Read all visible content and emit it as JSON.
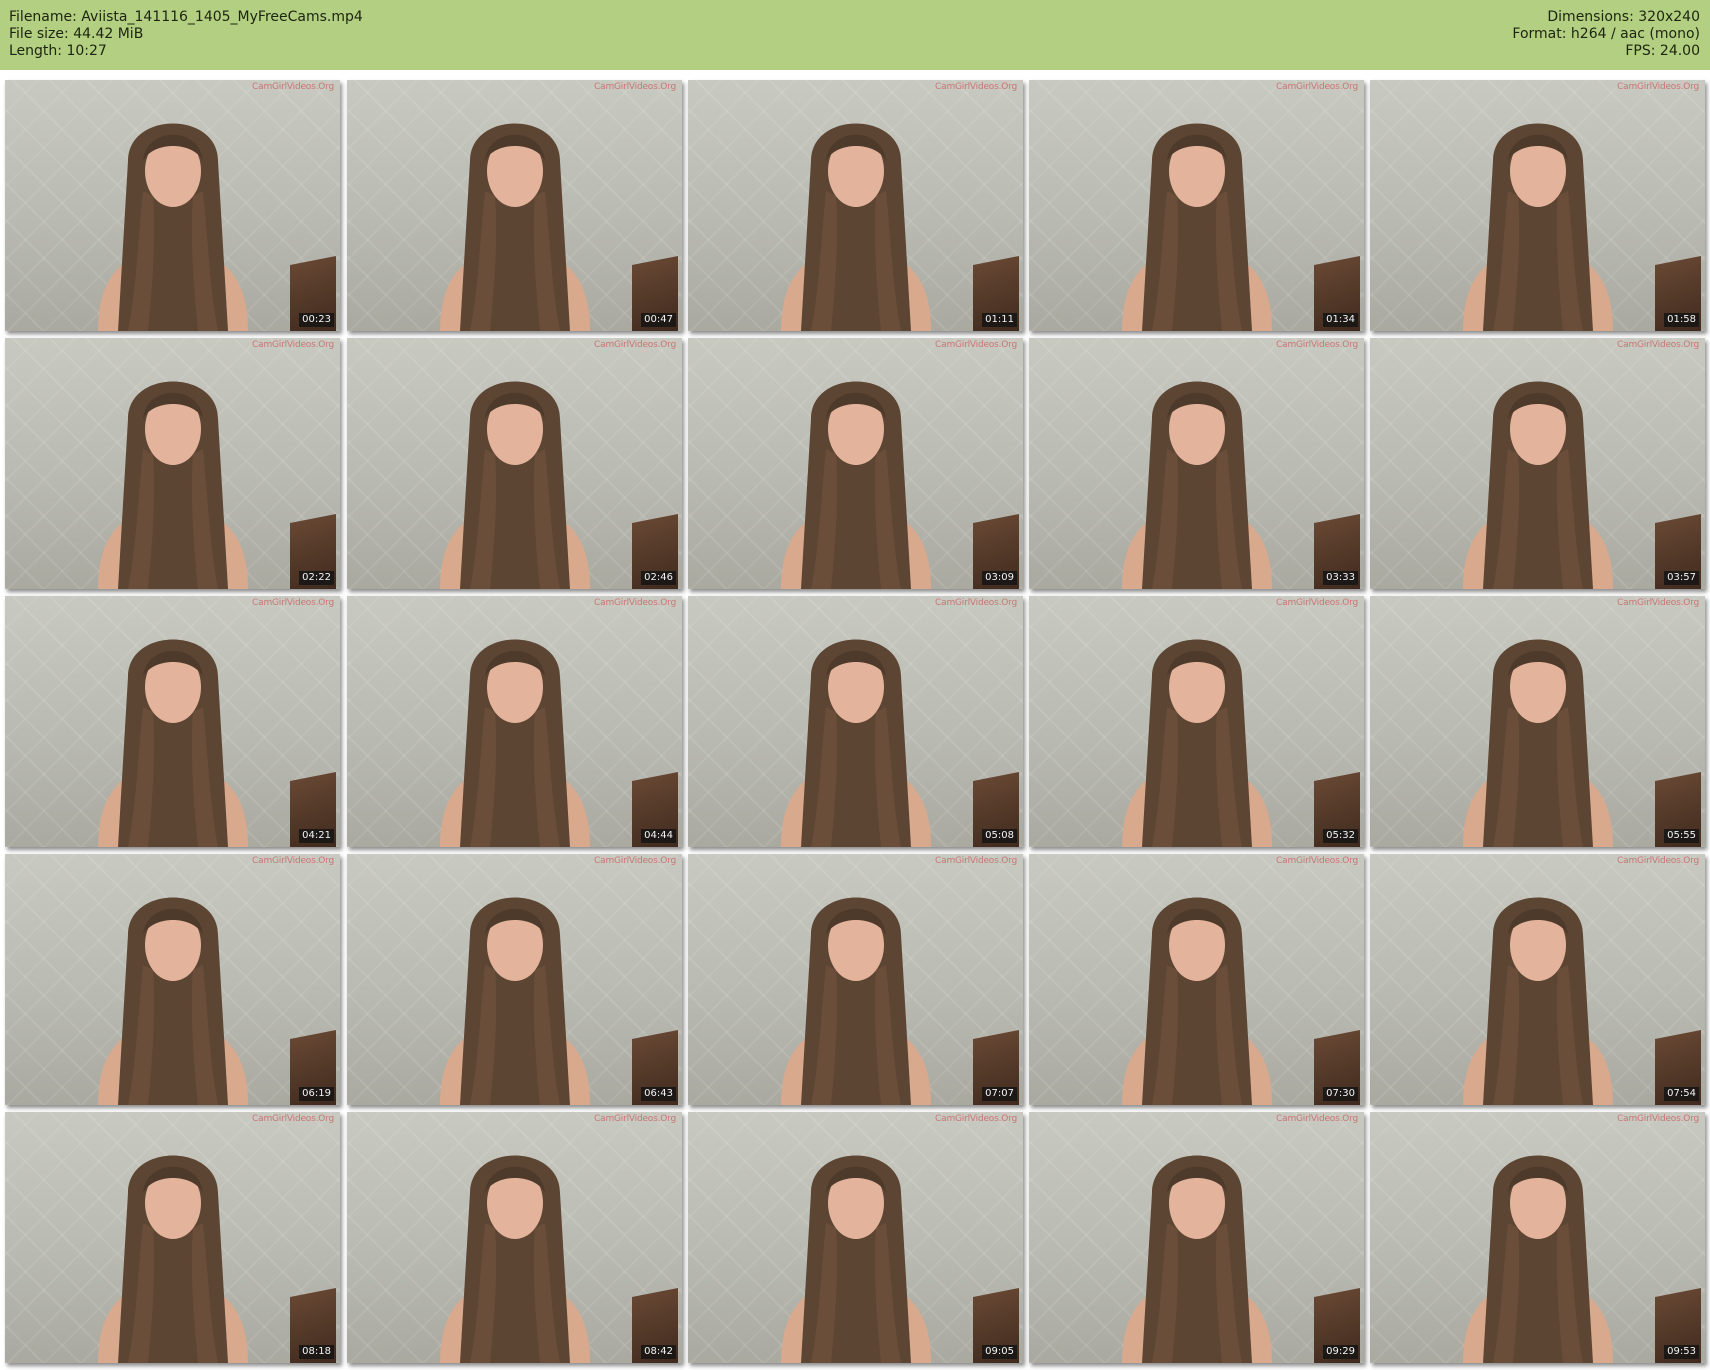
{
  "header": {
    "left": [
      "Filename: Aviista_141116_1405_MyFreeCams.mp4",
      "File size: 44.42 MiB",
      "Length: 10:27"
    ],
    "right": [
      "Dimensions: 320x240",
      "Format: h264 / aac (mono)",
      "FPS: 24.00"
    ]
  },
  "watermark": "CamGirlVideos.Org",
  "timestamps": [
    "00:23",
    "00:47",
    "01:11",
    "01:34",
    "01:58",
    "02:22",
    "02:46",
    "03:09",
    "03:33",
    "03:57",
    "04:21",
    "04:44",
    "05:08",
    "05:32",
    "05:55",
    "06:19",
    "06:43",
    "07:07",
    "07:30",
    "07:54",
    "08:18",
    "08:42",
    "09:05",
    "09:29",
    "09:53"
  ]
}
